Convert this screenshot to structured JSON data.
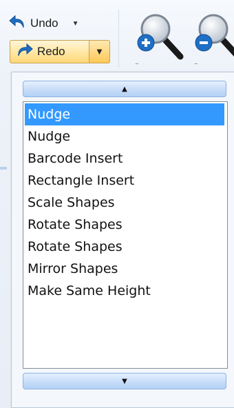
{
  "toolbar": {
    "undo_label": "Undo",
    "redo_label": "Redo",
    "zoom_in_icon": "zoom-in-icon",
    "zoom_out_icon": "zoom-out-icon"
  },
  "history_dropdown": {
    "items": [
      {
        "label": "Nudge",
        "selected": true
      },
      {
        "label": "Nudge",
        "selected": false
      },
      {
        "label": "Barcode Insert",
        "selected": false
      },
      {
        "label": "Rectangle Insert",
        "selected": false
      },
      {
        "label": "Scale Shapes",
        "selected": false
      },
      {
        "label": "Rotate Shapes",
        "selected": false
      },
      {
        "label": "Rotate Shapes",
        "selected": false
      },
      {
        "label": "Mirror Shapes",
        "selected": false
      },
      {
        "label": "Make Same Height",
        "selected": false
      }
    ]
  },
  "colors": {
    "selection": "#3399ff",
    "redo_highlight": "#ffd777",
    "scroll_button": "#c7ddf8"
  }
}
